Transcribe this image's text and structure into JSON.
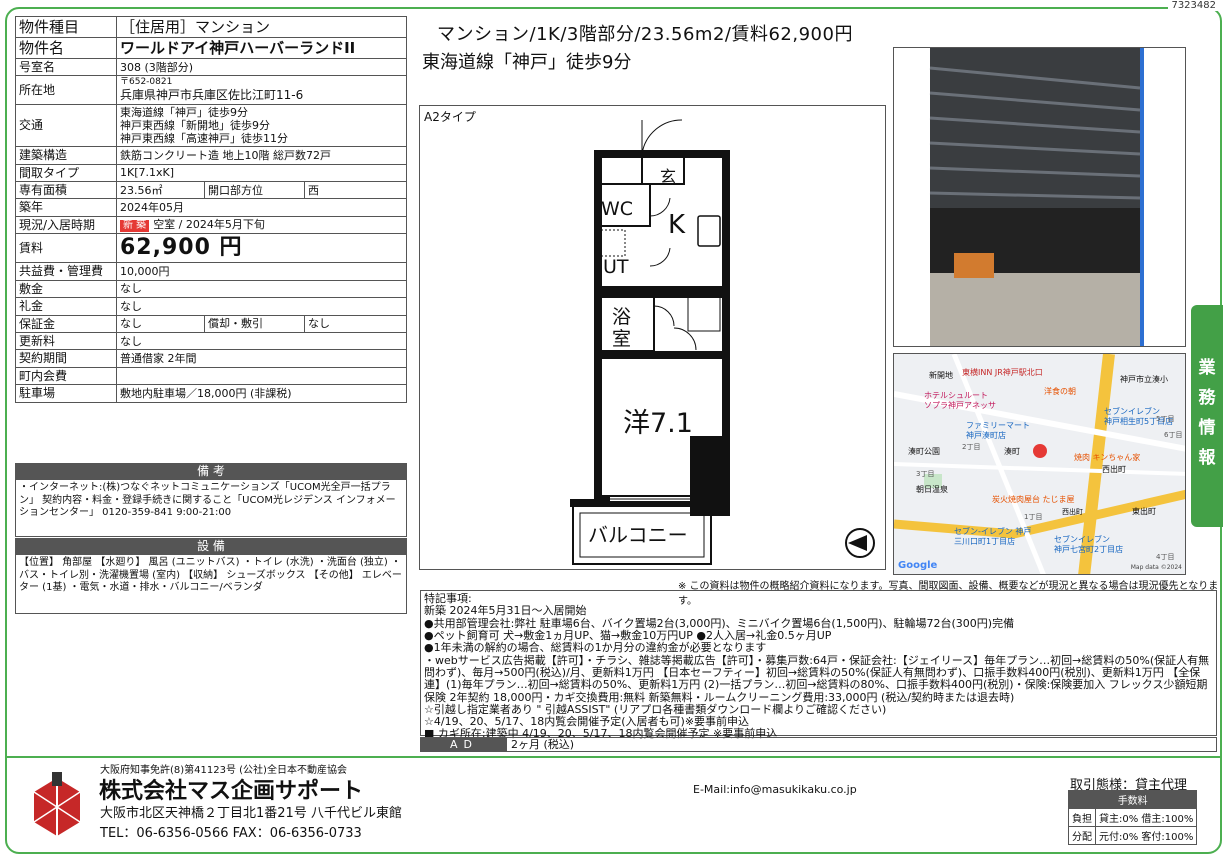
{
  "doc_id": "7323482",
  "spec": [
    {
      "k": "物件種目",
      "v": "［住居用］マンション",
      "big": true
    },
    {
      "k": "物件名",
      "v": "ワールドアイ神戸ハーバーランドII",
      "big": true
    },
    {
      "k": "号室名",
      "v": "308 (3階部分)"
    },
    {
      "k": "所在地",
      "v": "〒652-0821",
      "v2": "兵庫県神戸市兵庫区佐比江町11-6"
    },
    {
      "k": "交通",
      "v": "東海道線「神戸」徒歩9分",
      "v2": "神戸東西線「新開地」徒歩9分",
      "v3": "神戸東西線「高速神戸」徒歩11分"
    },
    {
      "k": "建築構造",
      "v": "鉄筋コンクリート造 地上10階 総戸数72戸"
    },
    {
      "k": "間取タイプ",
      "v": "1K[7.1xK]"
    },
    {
      "k": "専有面積",
      "v": "23.56㎡",
      "k2": "開口部方位",
      "v2": "西"
    },
    {
      "k": "築年",
      "v": "2024年05月"
    },
    {
      "k": "現況/入居時期",
      "badge": "新 築",
      "v": "空室 / 2024年5月下旬"
    },
    {
      "k": "賃料",
      "v": "62,900 円",
      "rent": true
    },
    {
      "k": "共益費・管理費",
      "v": "10,000円"
    },
    {
      "k": "敷金",
      "v": "なし"
    },
    {
      "k": "礼金",
      "v": "なし"
    },
    {
      "k": "保証金",
      "v": "なし",
      "k2": "償却・敷引",
      "v2": "なし"
    },
    {
      "k": "更新料",
      "v": "なし"
    },
    {
      "k": "契約期間",
      "v": "普通借家 2年間"
    },
    {
      "k": "町内会費",
      "v": ""
    },
    {
      "k": "駐車場",
      "v": "敷地内駐車場／18,000円 (非課税)"
    }
  ],
  "biko": {
    "heading": "備 考",
    "text": "・インターネット:(株)つなぐネットコミュニケーションズ「UCOM光全戸一括プラン」 契約内容・料金・登録手続きに関すること「UCOM光レジデンス インフォメーションセンター」 0120-359-841 9:00-21:00"
  },
  "setsubi": {
    "heading": "設 備",
    "text": "【位置】 角部屋 【水廻り】 風呂 (ユニットバス) ・トイレ (水洗) ・洗面台 (独立) ・バス・トイレ別・洗濯機置場 (室内) 【収納】 シューズボックス 【その他】 エレベーター (1基) ・電気・水道・排水・バルコニー/ベランダ"
  },
  "title_line1": "マンション/1K/3階部分/23.56m2/賃料62,900円",
  "title_line2": "東海道線「神戸」徒歩9分",
  "plan": {
    "type": "A2タイプ",
    "entrance": "玄",
    "wc": "WC",
    "kitchen": "K",
    "ut": "UT",
    "bath1": "浴",
    "bath2": "室",
    "room": "洋7.1",
    "balcony": "バルコニー"
  },
  "map": {
    "labels": [
      "新開地",
      "東横INN JR神戸駅北口",
      "神戸市立湊小",
      "ホテルシュルート",
      "ソプラ神戸アネッサ",
      "洋食の朝",
      "セブンイレブン",
      "神戸相生町5丁目店",
      "ファミリーマート",
      "神戸湊町店",
      "湊町公園",
      "湊町",
      "焼肉 キンちゃん家",
      "西出町",
      "朝日温泉",
      "炭火焼肉屋台 たじま屋",
      "西出町",
      "東出町",
      "セブン-イレブン 神戸",
      "三川口町1丁目店",
      "セブンイレブン",
      "神戸七宮町2丁目店",
      "2丁目",
      "1丁目",
      "3丁目",
      "6丁目",
      "5丁目",
      "4丁目"
    ],
    "google": "Google",
    "credit": "Map data ©2024"
  },
  "disclaimer": "※ この資料は物件の概略紹介資料になります。写真、間取図面、設備、概要などが現況と異なる場合は現況優先となります。",
  "notice_lines": [
    "特記事項:",
    "新築 2024年5月31日～入居開始",
    "●共用部管理会社:弊社 駐車場6台、バイク置場2台(3,000円)、ミニバイク置場6台(1,500円)、駐輪場72台(300円)完備",
    "●ペット飼育可 犬→敷金1ヵ月UP、猫→敷金10万円UP ●2人入居→礼金0.5ヶ月UP",
    "●1年未満の解約の場合、総賃料の1か月分の違約金が必要となります",
    "・webサービス広告掲載【許可】・チラシ、雑誌等掲載広告【許可】・募集戸数:64戸・保証会社:【ジェイリース】毎年プラン…初回→総賃料の50%(保証人有無問わず)、毎月→500円(税込)/月、更新料1万円 【日本セーフティー】初回→総賃料の50%(保証人有無問わず)、口振手数料400円(税別)、更新料1万円 【全保連】(1)毎年プラン…初回→総賃料の50%、更新料1万円 (2)一括プラン…初回→総賃料の80%、口振手数料400円(税別)・保険:保険要加入 フレックス少額短期保険 2年契約 18,000円・カギ交換費用:無料 新築無料・ルームクリーニング費用:33,000円 (税込/契約時または退去時)",
    "☆引越し指定業者あり \" 引越ASSIST\" (リアプロ各種書類ダウンロード欄よりご確認ください)",
    "☆4/19、20、5/17、18内覧会開催予定(入居者も可)※要事前申込",
    "■ カギ所在:建築中 4/19、20、5/17、18内覧会開催予定 ※要事前申込"
  ],
  "ad": {
    "label": "AD",
    "value": "2ヶ月 (税込)"
  },
  "side_tab": [
    "業",
    "務",
    "情",
    "報"
  ],
  "footer": {
    "license": "大阪府知事免許(8)第41123号 (公社)全日本不動産協会",
    "company": "株式会社マス企画サポート",
    "address": "大阪市北区天神橋２丁目北1番21号 八千代ビル東館",
    "tel": "TEL：06-6356-0566 FAX：06-6356-0733",
    "email": "E-Mail:info@masukikaku.co.jp",
    "torihiki": "取引態様：貸主代理",
    "fee_head": "手数料",
    "fee_rows": [
      {
        "k": "負担",
        "v": "貸主:0% 借主:100%"
      },
      {
        "k": "分配",
        "v": "元付:0% 客付:100%"
      }
    ]
  },
  "colors": {
    "accent": "#4caf50",
    "header_gray": "#555555",
    "badge_red": "#e53935"
  }
}
